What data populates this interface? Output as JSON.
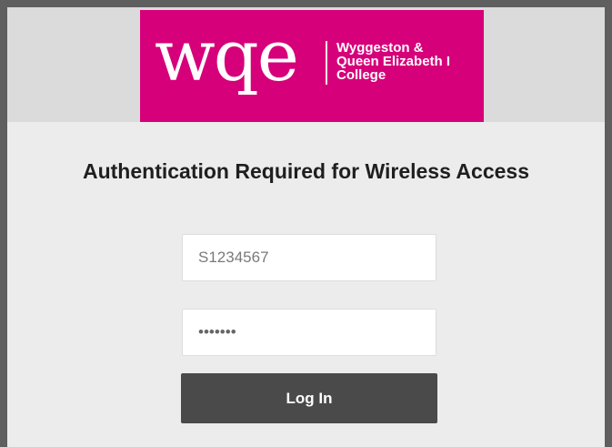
{
  "brand": {
    "logo_word": "wqe",
    "logo_line_1": "Wyggeston &",
    "logo_line_2": "Queen Elizabeth I",
    "logo_line_3": "College",
    "accent_color": "#d6007a"
  },
  "page": {
    "title": "Authentication Required for Wireless Access"
  },
  "login_form": {
    "username_value": "S1234567",
    "password_value": "1234567",
    "login_label": "Log In",
    "button_color": "#4a4a4a"
  }
}
